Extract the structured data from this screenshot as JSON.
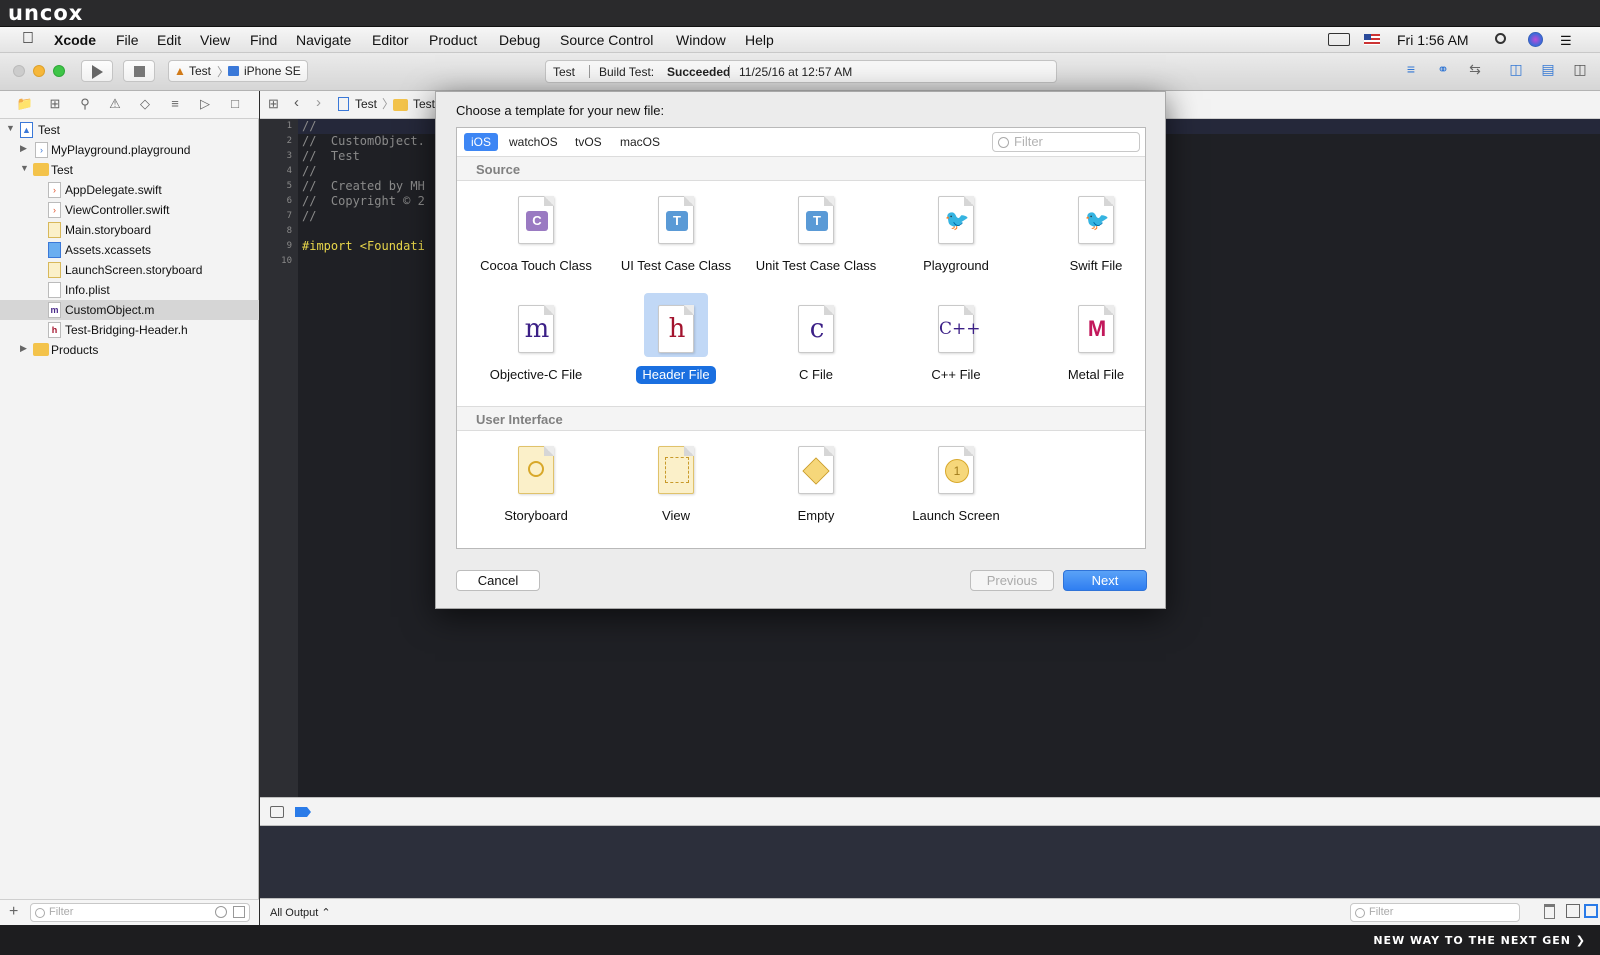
{
  "banner": {
    "logo": "uncox",
    "footer_tagline": "NEW WAY TO THE NEXT GEN ❯"
  },
  "menubar": {
    "app": "Xcode",
    "items": [
      "File",
      "Edit",
      "View",
      "Find",
      "Navigate",
      "Editor",
      "Product",
      "Debug",
      "Source Control",
      "Window",
      "Help"
    ],
    "clock": "Fri 1:56 AM"
  },
  "toolbar": {
    "scheme": "Test",
    "device": "iPhone SE",
    "activity": {
      "project": "Test",
      "status_prefix": "Build Test:",
      "status": "Succeeded",
      "timestamp": "11/25/16 at 12:57 AM"
    }
  },
  "navigator": {
    "tree": [
      {
        "label": "Test",
        "icon": "project-icon"
      },
      {
        "label": "MyPlayground.playground",
        "icon": "playground-file-icon"
      },
      {
        "label": "Test",
        "icon": "folder-icon"
      },
      {
        "label": "AppDelegate.swift",
        "icon": "swift-file-icon"
      },
      {
        "label": "ViewController.swift",
        "icon": "swift-file-icon"
      },
      {
        "label": "Main.storyboard",
        "icon": "storyboard-file-icon"
      },
      {
        "label": "Assets.xcassets",
        "icon": "asset-catalog-icon"
      },
      {
        "label": "LaunchScreen.storyboard",
        "icon": "storyboard-file-icon"
      },
      {
        "label": "Info.plist",
        "icon": "plist-file-icon"
      },
      {
        "label": "CustomObject.m",
        "icon": "objc-file-icon",
        "selected": true
      },
      {
        "label": "Test-Bridging-Header.h",
        "icon": "header-file-icon"
      },
      {
        "label": "Products",
        "icon": "folder-icon"
      }
    ],
    "filter_placeholder": "Filter"
  },
  "editor": {
    "breadcrumb": [
      "Test",
      "Test"
    ],
    "line_numbers": [
      "1",
      "2",
      "3",
      "4",
      "5",
      "6",
      "7",
      "8",
      "9",
      "10"
    ],
    "lines": [
      "//",
      "//  CustomObject.",
      "//  Test",
      "//",
      "//  Created by MH",
      "//  Copyright © 2",
      "//",
      "",
      "#import <Foundati",
      ""
    ]
  },
  "debug": {
    "output_selector": "All Output ⌃",
    "filter_placeholder": "Filter"
  },
  "dialog": {
    "title": "Choose a template for your new file:",
    "platforms": [
      "iOS",
      "watchOS",
      "tvOS",
      "macOS"
    ],
    "filter_placeholder": "Filter",
    "sections": {
      "source": {
        "title": "Source",
        "templates": [
          {
            "label": "Cocoa Touch Class",
            "glyph": "C",
            "icon": "cocoa-touch-class-icon"
          },
          {
            "label": "UI Test Case Class",
            "glyph": "T",
            "icon": "ui-test-case-class-icon"
          },
          {
            "label": "Unit Test Case Class",
            "glyph": "T",
            "icon": "unit-test-case-class-icon"
          },
          {
            "label": "Playground",
            "glyph": "🐦",
            "icon": "playground-icon"
          },
          {
            "label": "Swift File",
            "glyph": "🐦",
            "icon": "swift-file-icon"
          },
          {
            "label": "Objective-C File",
            "glyph": "m",
            "icon": "objective-c-file-icon"
          },
          {
            "label": "Header File",
            "glyph": "h",
            "icon": "header-file-icon",
            "selected": true
          },
          {
            "label": "C File",
            "glyph": "c",
            "icon": "c-file-icon"
          },
          {
            "label": "C++ File",
            "glyph": "C++",
            "icon": "cpp-file-icon"
          },
          {
            "label": "Metal File",
            "glyph": "M",
            "icon": "metal-file-icon"
          }
        ]
      },
      "ui": {
        "title": "User Interface",
        "templates": [
          {
            "label": "Storyboard",
            "icon": "storyboard-icon"
          },
          {
            "label": "View",
            "icon": "view-icon"
          },
          {
            "label": "Empty",
            "icon": "empty-icon"
          },
          {
            "label": "Launch Screen",
            "glyph": "1",
            "icon": "launch-screen-icon"
          }
        ]
      }
    },
    "buttons": {
      "cancel": "Cancel",
      "previous": "Previous",
      "next": "Next"
    }
  },
  "colors": {
    "accent": "#3d86f4",
    "selection": "#1a6fe0",
    "editor_bg": "#1f2025",
    "comment": "#8a8a8a",
    "preprocessor": "#e8d64a"
  }
}
